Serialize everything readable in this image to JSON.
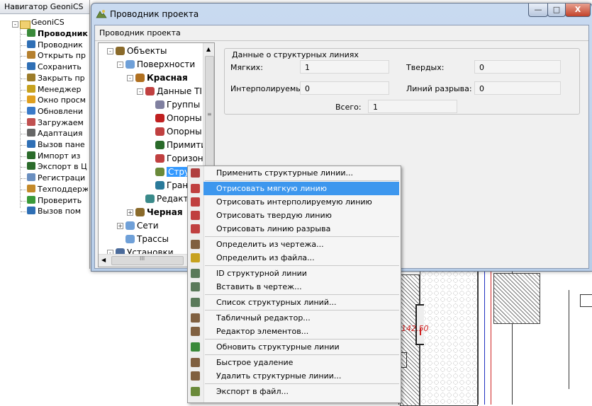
{
  "navigator": {
    "title": "Навигатор GeoniCS",
    "root": "GeoniCS",
    "items": [
      {
        "label": "Проводник",
        "bold": true,
        "color": "#3a8a3a"
      },
      {
        "label": "Проводник",
        "color": "#2f6fb5"
      },
      {
        "label": "Открыть пр",
        "color": "#b5802f"
      },
      {
        "label": "Сохранить",
        "color": "#2f6fb5"
      },
      {
        "label": "Закрыть пр",
        "color": "#9c7c2a"
      },
      {
        "label": "Менеджер",
        "color": "#c7a21f"
      },
      {
        "label": "Окно просм",
        "color": "#e0a020"
      },
      {
        "label": "Обновлени",
        "color": "#3a7ac9"
      },
      {
        "label": "Загружаем",
        "color": "#c05050"
      },
      {
        "label": "Адаптация",
        "color": "#666666"
      },
      {
        "label": "Вызов пане",
        "color": "#2f6fb5"
      },
      {
        "label": "Импорт из",
        "color": "#2b6b2b"
      },
      {
        "label": "Экспорт в Ц",
        "color": "#2b6b2b"
      },
      {
        "label": "Регистраци",
        "color": "#6a8fc0"
      },
      {
        "label": "Техподдерж",
        "color": "#c48a2a"
      },
      {
        "label": "Проверить",
        "color": "#3a9a3a"
      },
      {
        "label": "Вызов пом",
        "color": "#2f6fb5"
      }
    ]
  },
  "window": {
    "title": "Проводник проекта",
    "header": "Проводник проекта",
    "minimize": "—",
    "maximize": "□",
    "close": "X"
  },
  "tree": {
    "items": [
      {
        "label": "Объекты",
        "icon": "objects-icon"
      },
      {
        "label": "Поверхности",
        "icon": "surfaces-icon"
      },
      {
        "label": "Красная",
        "icon": "surface-red-icon",
        "bold": true
      },
      {
        "label": "Данные TIN",
        "icon": "tin-data-icon"
      },
      {
        "label": "Группы т",
        "icon": "point-groups-icon"
      },
      {
        "label": "Опорны",
        "icon": "base-points-icon"
      },
      {
        "label": "Опорны",
        "icon": "base-lines-icon"
      },
      {
        "label": "Примити",
        "icon": "primitives-icon"
      },
      {
        "label": "Горизон",
        "icon": "contours-icon"
      },
      {
        "label": "Структ",
        "icon": "structure-lines-icon",
        "selected": true
      },
      {
        "label": "Грани",
        "icon": "boundaries-icon"
      },
      {
        "label": "Редакти",
        "icon": "editor-icon"
      },
      {
        "label": "Черная",
        "icon": "surface-black-icon",
        "bold": true
      },
      {
        "label": "Сети",
        "icon": "networks-icon"
      },
      {
        "label": "Трассы",
        "icon": "routes-icon"
      },
      {
        "label": "Установки",
        "icon": "settings-icon"
      }
    ],
    "scroll_marker": "III"
  },
  "structure_data": {
    "group_title": "Данные о структурных линиях",
    "soft_label": "Мягких:",
    "soft_value": "1",
    "hard_label": "Твердых:",
    "hard_value": "0",
    "interp_label": "Интерполируемых:",
    "interp_value": "0",
    "break_label": "Линий разрыва:",
    "break_value": "0",
    "total_label": "Всего:",
    "total_value": "1"
  },
  "context_menu": {
    "items": [
      {
        "label": "Применить структурные линии...",
        "color": "#b04040"
      },
      {
        "label": "Отрисовать мягкую линию",
        "color": "#c04040",
        "highlighted": true
      },
      {
        "label": "Отрисовать интерполируемую линию",
        "color": "#c04040"
      },
      {
        "label": "Отрисовать твердую линию",
        "color": "#c04040"
      },
      {
        "label": "Отрисовать линию разрыва",
        "color": "#c04040"
      },
      {
        "label": "Определить из чертежа...",
        "color": "#806040"
      },
      {
        "label": "Определить из файла...",
        "color": "#c7a21f"
      },
      {
        "label": "ID структурной линии",
        "color": "#5a7a5a"
      },
      {
        "label": "Вставить в чертеж...",
        "color": "#5a7a5a"
      },
      {
        "label": "Список структурных линий...",
        "color": "#5a7a5a"
      },
      {
        "label": "Табличный редактор...",
        "color": "#806040"
      },
      {
        "label": "Редактор элементов...",
        "color": "#806040"
      },
      {
        "label": "Обновить структурные линии",
        "color": "#3a8a3a"
      },
      {
        "label": "Быстрое удаление",
        "color": "#806040"
      },
      {
        "label": "Удалить структурные линии...",
        "color": "#806040"
      },
      {
        "label": "Экспорт в файл...",
        "color": "#6a8a3a"
      }
    ]
  },
  "drawing": {
    "label": "142.50",
    "label_color": "#d02020"
  }
}
